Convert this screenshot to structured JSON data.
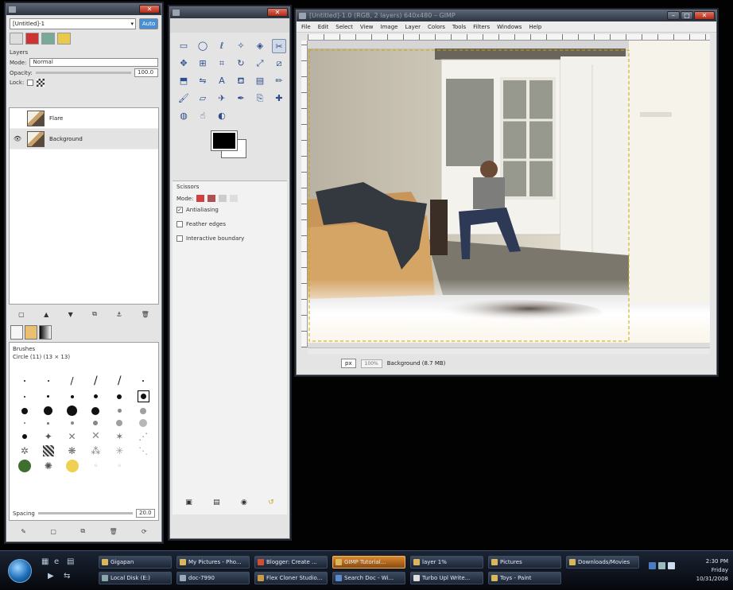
{
  "image_window": {
    "title": "[Untitled]-1.0 (RGB, 2 layers) 640x480 – GIMP",
    "menus": [
      "File",
      "Edit",
      "Select",
      "View",
      "Image",
      "Layer",
      "Colors",
      "Tools",
      "Filters",
      "Windows",
      "Help"
    ],
    "unit": "px",
    "zoom": "100%",
    "status_text": "Background (8.7 MB)"
  },
  "layers_window": {
    "image_selector": "[Untitled]-1",
    "auto_button": "Auto",
    "panel_title": "Layers",
    "mode_label": "Mode:",
    "mode_value": "Normal",
    "opacity_label": "Opacity:",
    "opacity_value": "100.0",
    "lock_label": "Lock:",
    "layers": [
      {
        "name": "Flare",
        "visible": false
      },
      {
        "name": "Background",
        "visible": true
      }
    ],
    "brushes_title": "Brushes",
    "brush_info": "Circle (11) (13 × 13)",
    "spacing_label": "Spacing",
    "spacing_value": "20.0"
  },
  "toolbox": {
    "options_title": "Scissors",
    "mode_label": "Mode:",
    "options": [
      {
        "label": "Antialiasing",
        "checked": true
      },
      {
        "label": "Feather edges",
        "checked": false
      },
      {
        "label": "Interactive boundary",
        "checked": false
      }
    ],
    "fg_color": "#000000",
    "bg_color": "#ffffff"
  },
  "taskbar": {
    "tasks_top": [
      {
        "label": "Gigapan",
        "active": false
      },
      {
        "label": "My Pictures - Pho...",
        "active": false
      },
      {
        "label": "Blogger: Create ...",
        "active": false
      },
      {
        "label": "GIMP Tutorial...",
        "active": true
      },
      {
        "label": "layer 1%",
        "active": false
      },
      {
        "label": "Pictures",
        "active": false
      },
      {
        "label": "Downloads/Movies",
        "active": false
      }
    ],
    "tasks_bottom": [
      {
        "label": "Local Disk (E:)",
        "active": false
      },
      {
        "label": "doc-7990",
        "active": false
      },
      {
        "label": "Flex Cloner Studio...",
        "active": false
      },
      {
        "label": "Search Doc - Wi...",
        "active": false
      },
      {
        "label": "Turbo Upl Write...",
        "active": false
      },
      {
        "label": "Toys - Paint",
        "active": false
      }
    ],
    "clock_time": "2:30 PM",
    "clock_day": "Friday",
    "clock_date": "10/31/2008"
  }
}
